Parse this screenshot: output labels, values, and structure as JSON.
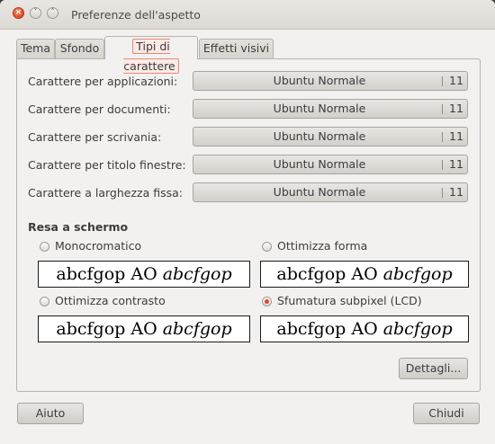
{
  "window": {
    "title": "Preferenze dell'aspetto",
    "close_glyph": "×",
    "min_glyph": "˅",
    "max_glyph": "˄"
  },
  "tabs": [
    {
      "label": "Tema",
      "active": false
    },
    {
      "label": "Sfondo",
      "active": false
    },
    {
      "label": "Tipi di carattere",
      "active": true
    },
    {
      "label": "Effetti visivi",
      "active": false
    }
  ],
  "fonts": [
    {
      "label": "Carattere per applicazioni:",
      "font": "Ubuntu Normale",
      "size": "11"
    },
    {
      "label": "Carattere per documenti:",
      "font": "Ubuntu Normale",
      "size": "11"
    },
    {
      "label": "Carattere per scrivania:",
      "font": "Ubuntu Normale",
      "size": "11"
    },
    {
      "label": "Carattere per titolo finestre:",
      "font": "Ubuntu Normale",
      "size": "11"
    },
    {
      "label": "Carattere a larghezza fissa:",
      "font": "Ubuntu Normale",
      "size": "11"
    }
  ],
  "rendering": {
    "title": "Resa a schermo",
    "options": [
      {
        "label": "Monocromatico",
        "selected": false,
        "preview_plain": "abcfgop AO ",
        "preview_italic": "abcfgop"
      },
      {
        "label": "Ottimizza forma",
        "selected": false,
        "preview_plain": "abcfgop AO ",
        "preview_italic": "abcfgop"
      },
      {
        "label": "Ottimizza contrasto",
        "selected": false,
        "preview_plain": "abcfgop AO ",
        "preview_italic": "abcfgop"
      },
      {
        "label": "Sfumatura subpixel (LCD)",
        "selected": true,
        "preview_plain": "abcfgop AO ",
        "preview_italic": "abcfgop"
      }
    ]
  },
  "buttons": {
    "details": "Dettagli...",
    "help": "Aiuto",
    "close": "Chiudi"
  },
  "colors": {
    "accent": "#e0482a",
    "window_bg": "#f2f1f0"
  }
}
